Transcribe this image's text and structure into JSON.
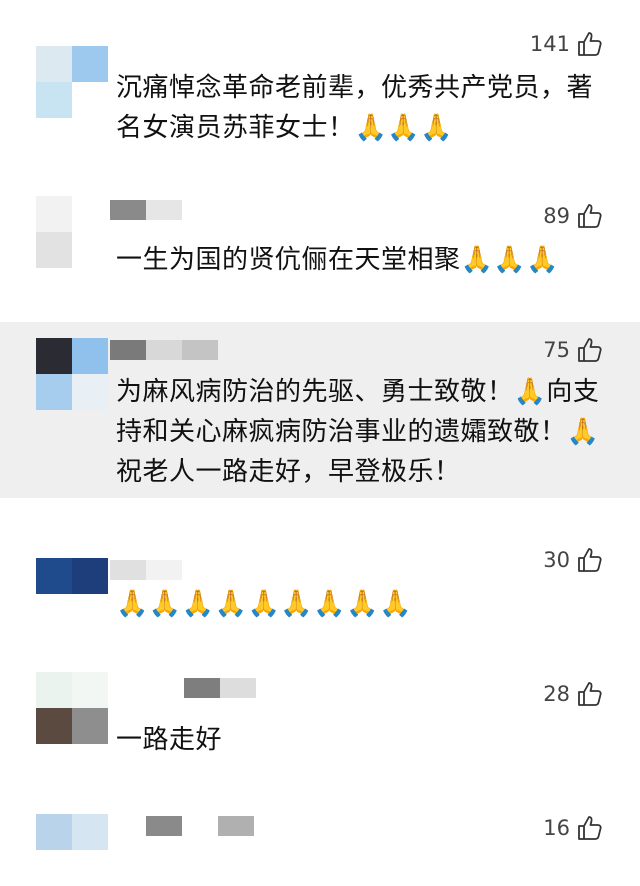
{
  "comments": [
    {
      "likes": "141",
      "text": "沉痛悼念革命老前辈，优秀共产党员，著名女演员苏菲女士！🙏🙏🙏",
      "avatar_colors": [
        "#dce9f0",
        "#9ec9ee",
        "#c8e3f2",
        "#ffffff"
      ],
      "username_colors": []
    },
    {
      "likes": "89",
      "text": "一生为国的贤伉俪在天堂相聚🙏🙏🙏",
      "avatar_colors": [
        "#f2f2f2",
        "#ffffff",
        "#e2e2e2",
        "#ffffff"
      ],
      "username_colors": [
        "#8a8a8a",
        "#e6e6e6"
      ]
    },
    {
      "likes": "75",
      "text": "为麻风病防治的先驱、勇士致敬！🙏向支持和关心麻疯病防治事业的遗孀致敬！🙏祝老人一路走好，早登极乐！",
      "avatar_colors": [
        "#2b2b33",
        "#8fc1ec",
        "#a7cdee",
        "#e8f0f6"
      ],
      "username_colors": [
        "#7a7a7a",
        "#d8d8d8",
        "#c4c4c4"
      ]
    },
    {
      "likes": "30",
      "text": "🙏🙏🙏🙏🙏🙏🙏🙏🙏",
      "avatar_colors": [
        "#ffffff",
        "#ffffff",
        "#1f4a8c",
        "#1d3e7a"
      ],
      "username_colors": [
        "#e0e0e0",
        "#f2f2f2"
      ]
    },
    {
      "likes": "28",
      "text": "一路走好",
      "avatar_colors": [
        "#ebf3ee",
        "#f3f7f4",
        "#5b4a3f",
        "#8e8e8e"
      ],
      "username_colors": [
        "#7e7e7e",
        "#dddddd"
      ]
    },
    {
      "likes": "16",
      "text": "",
      "avatar_colors": [
        "#b9d4ea",
        "#d5e6f2",
        "#ffffff",
        "#ffffff"
      ],
      "username_colors": [
        "#8a8a8a",
        "#ffffff",
        "#b0b0b0"
      ]
    }
  ],
  "icons": {
    "like": "thumbs-up-icon"
  }
}
